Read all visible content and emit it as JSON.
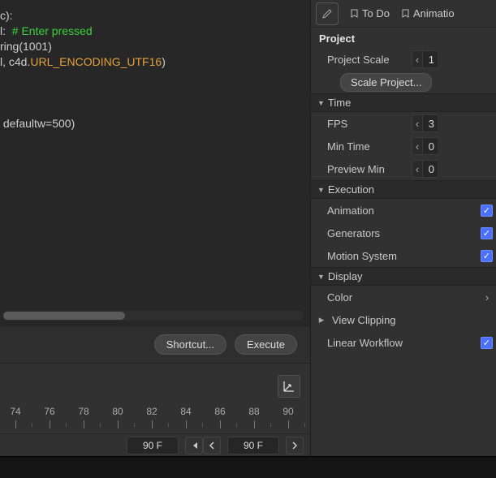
{
  "code": {
    "lines": [
      {
        "segs": [
          {
            "t": "c):",
            "c": "tok-punct"
          }
        ]
      },
      {
        "segs": [
          {
            "t": "l:  ",
            "c": "tok-punct"
          },
          {
            "t": "# Enter pressed",
            "c": "tok-comment"
          }
        ]
      },
      {
        "segs": [
          {
            "t": "ring(",
            "c": "tok-punct"
          },
          {
            "t": "1001",
            "c": "tok-num"
          },
          {
            "t": ")",
            "c": "tok-punct"
          }
        ]
      },
      {
        "segs": [
          {
            "t": "l, c4d.",
            "c": "tok-punct"
          },
          {
            "t": "URL_ENCODING_UTF16",
            "c": "tok-const"
          },
          {
            "t": ")",
            "c": "tok-punct"
          }
        ]
      },
      {
        "segs": []
      },
      {
        "segs": []
      },
      {
        "segs": []
      },
      {
        "segs": [
          {
            "t": " defaultw=",
            "c": "tok-punct"
          },
          {
            "t": "500",
            "c": "tok-num"
          },
          {
            "t": ")",
            "c": "tok-punct"
          }
        ]
      }
    ]
  },
  "toolbar": {
    "shortcut_label": "Shortcut...",
    "execute_label": "Execute"
  },
  "timeline": {
    "ticks": [
      "74",
      "76",
      "78",
      "80",
      "82",
      "84",
      "86",
      "88",
      "90"
    ],
    "frame_a": "90 F",
    "frame_b": "90 F"
  },
  "panel": {
    "tabs": {
      "todo": "To Do",
      "animation": "Animatio"
    },
    "heading": "Project",
    "rows": {
      "project_scale_label": "Project Scale",
      "project_scale_val": "1",
      "scale_project_btn": "Scale Project..."
    },
    "time": {
      "header": "Time",
      "fps_label": "FPS",
      "fps_val": "3",
      "min_time_label": "Min Time",
      "min_time_val": "0",
      "preview_min_label": "Preview Min",
      "preview_min_val": "0"
    },
    "execution": {
      "header": "Execution",
      "animation_label": "Animation",
      "generators_label": "Generators",
      "motion_label": "Motion System"
    },
    "display": {
      "header": "Display",
      "color_label": "Color",
      "view_clip_label": "View Clipping",
      "linear_label": "Linear Workflow"
    }
  }
}
